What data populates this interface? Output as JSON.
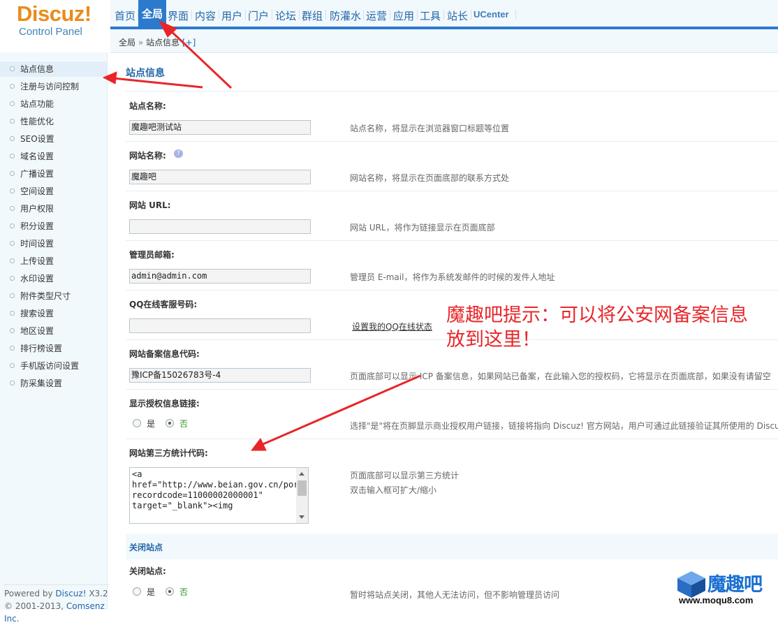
{
  "brand": {
    "logo": "Discuz!",
    "subtitle": "Control Panel"
  },
  "nav": {
    "items": [
      "首页",
      "全局",
      "界面",
      "内容",
      "用户",
      "门户",
      "论坛",
      "群组",
      "防灌水",
      "运营",
      "应用",
      "工具",
      "站长",
      "UCenter"
    ],
    "active": "全局"
  },
  "breadcrumb": {
    "root": "全局",
    "sep": "»",
    "current": "站点信息",
    "add": "[+]"
  },
  "sidebar": {
    "items": [
      "站点信息",
      "注册与访问控制",
      "站点功能",
      "性能优化",
      "SEO设置",
      "域名设置",
      "广播设置",
      "空间设置",
      "用户权限",
      "积分设置",
      "时间设置",
      "上传设置",
      "水印设置",
      "附件类型尺寸",
      "搜索设置",
      "地区设置",
      "排行榜设置",
      "手机版访问设置",
      "防采集设置"
    ],
    "active_index": 0,
    "footer_powered_prefix": "Powered by ",
    "footer_powered_link": "Discuz!",
    "footer_powered_version": " X3.2",
    "footer_copy_prefix": "© 2001-2013, ",
    "footer_copy_link": "Comsenz Inc."
  },
  "main": {
    "title": "站点信息",
    "fields": {
      "site_name": {
        "label": "站点名称:",
        "value": "魔趣吧测试站",
        "tip": "站点名称，将显示在浏览器窗口标题等位置"
      },
      "web_name": {
        "label": "网站名称:",
        "value": "魔趣吧",
        "tip": "网站名称，将显示在页面底部的联系方式处"
      },
      "web_url": {
        "label": "网站 URL:",
        "value": "",
        "tip": "网站 URL，将作为链接显示在页面底部"
      },
      "admin_email": {
        "label": "管理员邮箱:",
        "value": "admin@admin.com",
        "tip": "管理员 E-mail，将作为系统发邮件的时候的发件人地址"
      },
      "qq_service": {
        "label": "QQ在线客服号码:",
        "value": "",
        "link": "设置我的QQ在线状态"
      },
      "icp": {
        "label": "网站备案信息代码:",
        "value": "豫ICP备15026783号-4",
        "tip": "页面底部可以显示 ICP 备案信息，如果网站已备案，在此输入您的授权码，它将显示在页面底部，如果没有请留空"
      },
      "license_link": {
        "label": "显示授权信息链接:",
        "yes": "是",
        "no": "否",
        "selected": "no",
        "tip": "选择\"是\"将在页脚显示商业授权用户链接，链接将指向 Discuz! 官方网站，用户可通过此链接验证其所使用的 Discuz"
      },
      "stats_code": {
        "label": "网站第三方统计代码:",
        "value": "<a href=\"http://www.beian.gov.cn/portal/registerSystemInfo?recordcode=11000002000001\" target=\"_blank\"><img",
        "tip_line1": "页面底部可以显示第三方统计",
        "tip_line2": "双击输入框可扩大/缩小"
      }
    },
    "close_section": {
      "title": "关闭站点",
      "label": "关闭站点:",
      "yes": "是",
      "no": "否",
      "selected": "no",
      "tip": "暂时将站点关闭，其他人无法访问，但不影响管理员访问"
    }
  },
  "annotation": {
    "text_line1": "魔趣吧提示：可以将公安网备案信息",
    "text_line2": "放到这里！",
    "color": "#e8262a"
  },
  "watermark": {
    "logo": "魔趣吧",
    "url": "www.moqu8.com"
  }
}
